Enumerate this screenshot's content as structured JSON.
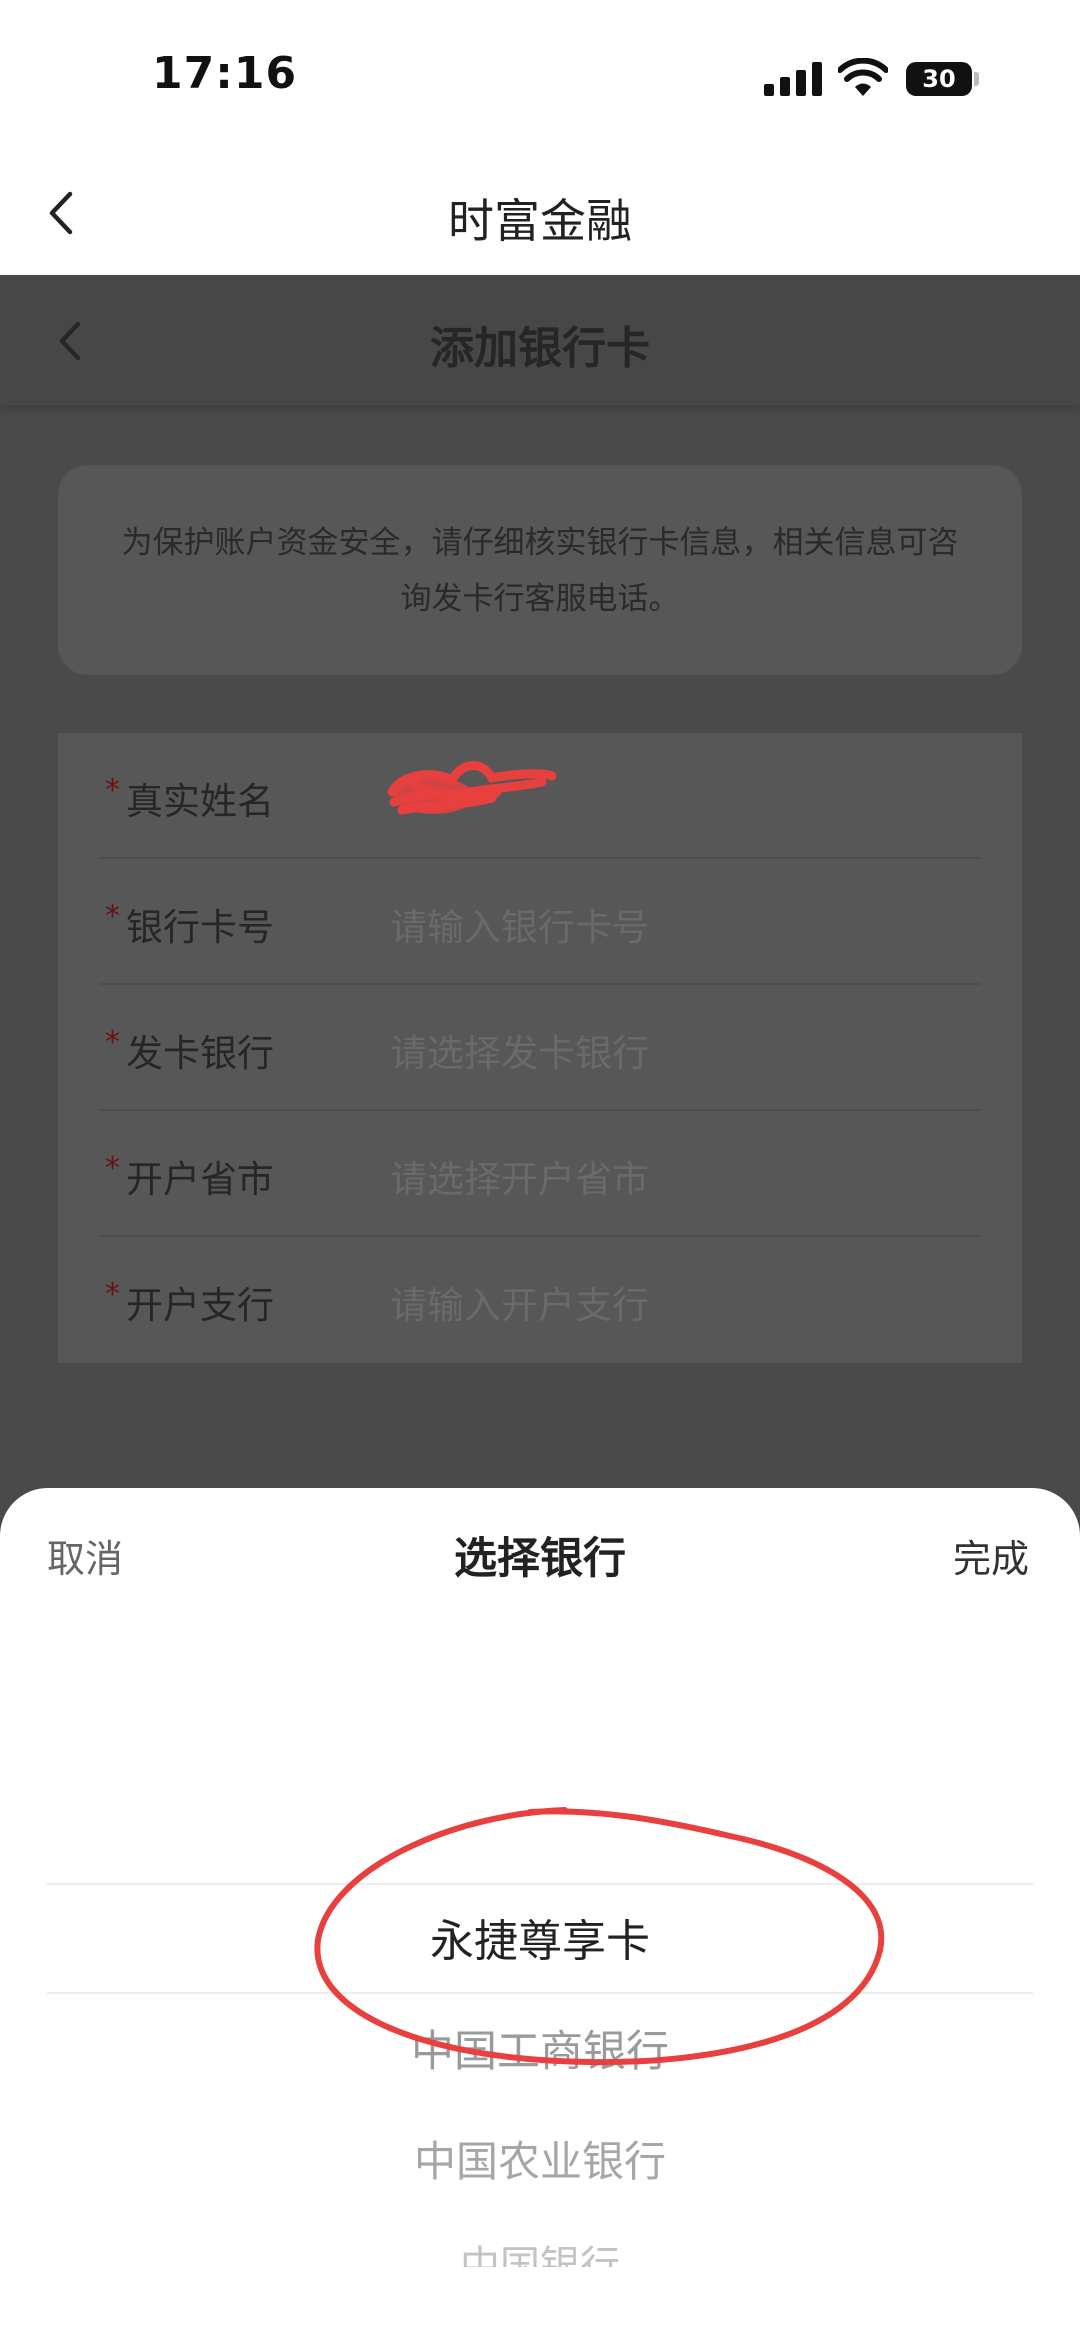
{
  "status_bar": {
    "time": "17:16",
    "battery": "30",
    "icons": [
      "signal-icon",
      "wifi-icon",
      "battery-icon"
    ]
  },
  "app_header": {
    "title": "时富金融",
    "back_icon": "chevron-left-icon"
  },
  "page": {
    "title": "添加银行卡",
    "back_icon": "chevron-left-icon",
    "notice": "为保护账户资金安全，请仔细核实银行卡信息，相关信息可咨询发卡行客服电话。",
    "required_mark": "*",
    "fields": [
      {
        "label": "真实姓名",
        "value": ""
      },
      {
        "label": "银行卡号",
        "placeholder": "请输入银行卡号"
      },
      {
        "label": "发卡银行",
        "placeholder": "请选择发卡银行"
      },
      {
        "label": "开户省市",
        "placeholder": "请选择开户省市"
      },
      {
        "label": "开户支行",
        "placeholder": "请输入开户支行"
      }
    ]
  },
  "picker": {
    "cancel": "取消",
    "title": "选择银行",
    "done": "完成",
    "options": [
      "永捷尊享卡",
      "中国工商银行",
      "中国农业银行",
      "中国银行"
    ],
    "selected": "永捷尊享卡"
  },
  "colors": {
    "overlay_page": "#4a4a4a",
    "required_star": "#6b1010",
    "annotation_red": "#e8403f"
  }
}
